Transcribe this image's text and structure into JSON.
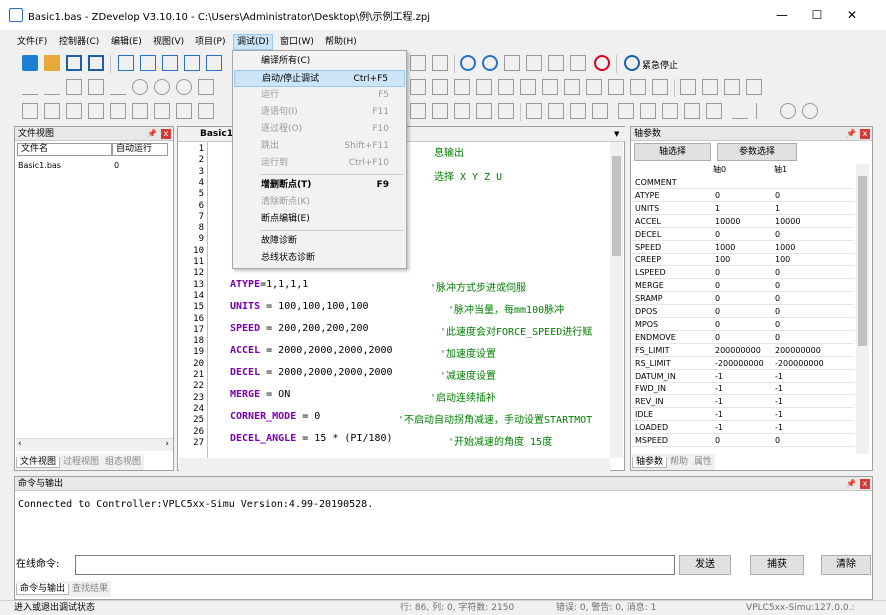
{
  "window": {
    "title": "Basic1.bas - ZDevelop V3.10.10 - C:\\Users\\Administrator\\Desktop\\例\\示例工程.zpj",
    "minimize": "—",
    "maximize": "☐",
    "close": "✕"
  },
  "menu": [
    "文件(F)",
    "控制器(C)",
    "编辑(E)",
    "视图(V)",
    "项目(P)",
    "调试(D)",
    "窗口(W)",
    "帮助(H)"
  ],
  "toolbar": {
    "emergency_stop": "紧急停止"
  },
  "debug_menu": [
    {
      "label": "编译所有(C)",
      "shortcut": "",
      "state": "normal"
    },
    {
      "label": "启动/停止调试",
      "shortcut": "Ctrl+F5",
      "state": "highlight"
    },
    {
      "label": "运行",
      "shortcut": "F5",
      "state": "disabled"
    },
    {
      "label": "逐语句(I)",
      "shortcut": "F11",
      "state": "disabled"
    },
    {
      "label": "逐过程(O)",
      "shortcut": "F10",
      "state": "disabled"
    },
    {
      "label": "跳出",
      "shortcut": "Shift+F11",
      "state": "disabled"
    },
    {
      "label": "运行到",
      "shortcut": "Ctrl+F10",
      "state": "disabled"
    },
    {
      "label": "增删断点(T)",
      "shortcut": "F9",
      "state": "bold"
    },
    {
      "label": "清除断点(K)",
      "shortcut": "",
      "state": "disabled"
    },
    {
      "label": "断点编辑(E)",
      "shortcut": "",
      "state": "normal"
    },
    {
      "label": "故障诊断",
      "shortcut": "",
      "state": "normal"
    },
    {
      "label": "总线状态诊断",
      "shortcut": "",
      "state": "normal"
    }
  ],
  "file_view": {
    "title": "文件视图",
    "col_name": "文件名",
    "col_auto": "自动运行",
    "rows": [
      {
        "name": "Basic1.bas",
        "auto": "0"
      }
    ],
    "tabs": [
      "文件视图",
      "过程视图",
      "组态视图"
    ]
  },
  "editor": {
    "tab": "Basic1.",
    "line_numbers": [
      "1",
      "2",
      "3",
      "4",
      "5",
      "6",
      "7",
      "8",
      "9",
      "10",
      "11",
      "12",
      "13",
      "14",
      "15",
      "16",
      "17",
      "18",
      "19",
      "20",
      "21",
      "22",
      "23",
      "24",
      "25",
      "26",
      "27"
    ],
    "frag_top1": "息输出",
    "frag_top2": "选择 X Y Z U",
    "lines": [
      {
        "kw": "ATYPE",
        "rest": "=1,1,1,1",
        "comment": "'脉冲方式步进或伺服"
      },
      {
        "kw": "UNITS",
        "rest": " = 100,100,100,100",
        "comment": "'脉冲当量，每mm100脉冲"
      },
      {
        "kw": "SPEED",
        "rest": " = 200,200,200,200",
        "comment": "'此速度会对FORCE_SPEED进行赋"
      },
      {
        "kw": "ACCEL",
        "rest": " = 2000,2000,2000,2000",
        "comment": "'加速度设置"
      },
      {
        "kw": "DECEL",
        "rest": " = 2000,2000,2000,2000",
        "comment": "'减速度设置"
      },
      {
        "kw": "MERGE",
        "rest": " = ON",
        "comment": "'启动连续插补"
      },
      {
        "kw": "CORNER_MODE",
        "rest": " = 0",
        "comment": "'不启动自动拐角减速，手动设置STARTMOT"
      },
      {
        "kw": "DECEL_ANGLE",
        "rest": " = 15 * (PI/180)",
        "comment": "'开始减速的角度 15度"
      }
    ]
  },
  "axis_params": {
    "title": "轴参数",
    "btn_axis": "轴选择",
    "btn_param": "参数选择",
    "cols": [
      "轴0",
      "轴1"
    ],
    "rows": [
      [
        "COMMENT",
        "",
        ""
      ],
      [
        "ATYPE",
        "0",
        "0"
      ],
      [
        "UNITS",
        "1",
        "1"
      ],
      [
        "ACCEL",
        "10000",
        "10000"
      ],
      [
        "DECEL",
        "0",
        "0"
      ],
      [
        "SPEED",
        "1000",
        "1000"
      ],
      [
        "CREEP",
        "100",
        "100"
      ],
      [
        "LSPEED",
        "0",
        "0"
      ],
      [
        "MERGE",
        "0",
        "0"
      ],
      [
        "SRAMP",
        "0",
        "0"
      ],
      [
        "DPOS",
        "0",
        "0"
      ],
      [
        "MPOS",
        "0",
        "0"
      ],
      [
        "ENDMOVE",
        "0",
        "0"
      ],
      [
        "FS_LIMIT",
        "200000000",
        "200000000"
      ],
      [
        "RS_LIMIT",
        "-200000000",
        "-200000000"
      ],
      [
        "DATUM_IN",
        "-1",
        "-1"
      ],
      [
        "FWD_IN",
        "-1",
        "-1"
      ],
      [
        "REV_IN",
        "-1",
        "-1"
      ],
      [
        "IDLE",
        "-1",
        "-1"
      ],
      [
        "LOADED",
        "-1",
        "-1"
      ],
      [
        "MSPEED",
        "0",
        "0"
      ]
    ],
    "tabs": [
      "轴参数",
      "帮助",
      "属性"
    ]
  },
  "command": {
    "title": "命令与输出",
    "output": "Connected to Controller:VPLC5xx-Simu Version:4.99-20190528.",
    "online_label": "在线命令:",
    "send": "发送",
    "capture": "捕获",
    "clear": "清除",
    "tabs": [
      "命令与输出",
      "查找结果"
    ]
  },
  "status": {
    "left": "进入或退出调试状态",
    "pos": "行: 86, 列: 0, 字符数: 2150",
    "errors": "错误: 0, 警告: 0, 消息: 1",
    "controller": "VPLC5xx-Simu:127.0.0.:"
  },
  "colors": {
    "accent": "#0078d7",
    "menu_highlight": "#cce4f7",
    "keyword": "#7a00b0",
    "comment": "#008000",
    "stop_red": "#d9001b"
  }
}
